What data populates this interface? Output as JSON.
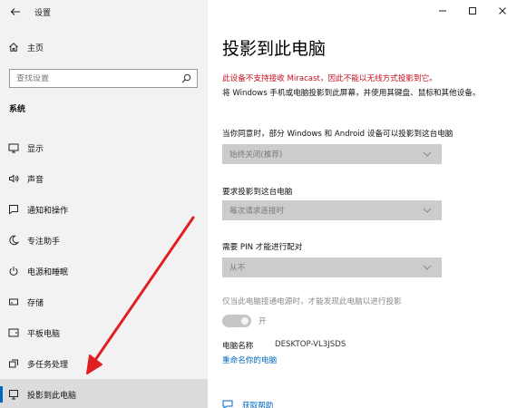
{
  "window": {
    "app_title": "设置",
    "controls": [
      "minimize",
      "maximize",
      "close"
    ]
  },
  "sidebar": {
    "home_label": "主页",
    "search_placeholder": "查找设置",
    "section_title": "系统",
    "items": [
      {
        "label": "显示",
        "icon": "display-icon"
      },
      {
        "label": "声音",
        "icon": "speaker-icon"
      },
      {
        "label": "通知和操作",
        "icon": "notification-icon"
      },
      {
        "label": "专注助手",
        "icon": "moon-icon"
      },
      {
        "label": "电源和睡眠",
        "icon": "power-icon"
      },
      {
        "label": "存储",
        "icon": "storage-icon"
      },
      {
        "label": "平板电脑",
        "icon": "tablet-icon"
      },
      {
        "label": "多任务处理",
        "icon": "multitask-icon"
      },
      {
        "label": "投影到此电脑",
        "icon": "project-icon",
        "active": true
      }
    ]
  },
  "main": {
    "title": "投影到此电脑",
    "warning": "此设备不支持接收 Miracast，因此不能以无线方式投影到它。",
    "description": "将 Windows 手机或电脑投影到此屏幕，并使用其键盘、鼠标和其他设备。",
    "setting1": {
      "label": "当你同意时，部分 Windows 和 Android 设备可以投影到这台电脑",
      "value": "始终关闭(推荐)"
    },
    "setting2": {
      "label": "要求投影到这台电脑",
      "value": "每次请求连接时"
    },
    "setting3": {
      "label": "需要 PIN 才能进行配对",
      "value": "从不"
    },
    "power_label": "仅当此电脑接通电源时，才能发现此电脑以进行投影",
    "toggle_text": "开",
    "pc_name_label": "电脑名称",
    "pc_name_value": "DESKTOP-VL3JSDS",
    "rename_link": "重命名你的电脑",
    "help_link": "获取帮助"
  },
  "colors": {
    "accent": "#0067c0",
    "warning": "#c50f1f",
    "arrow": "#e02020",
    "sidebar_bg": "#f2f2f2",
    "active_bg": "#dcdcdc"
  }
}
